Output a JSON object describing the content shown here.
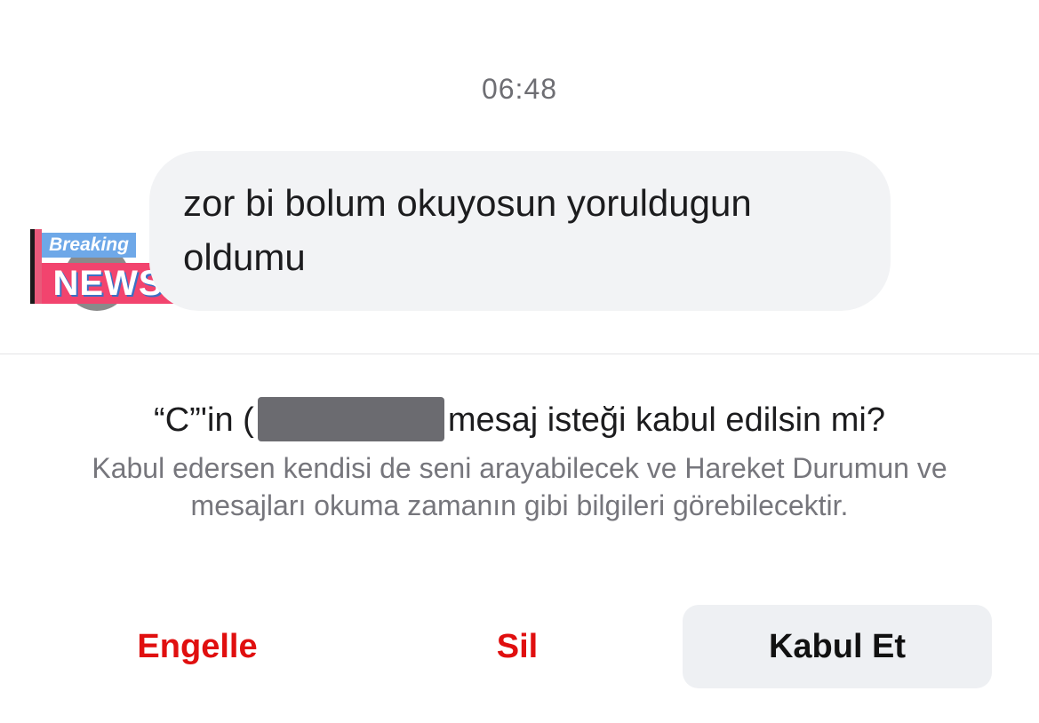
{
  "conversation": {
    "timestamp": "06:48",
    "message": {
      "text": "zor bi bolum okuyosun yoruldugun oldumu"
    },
    "avatar": {
      "line1": "Breaking",
      "line2": "NEWS"
    }
  },
  "request": {
    "title_prefix": "“C”'in (",
    "title_suffix": "mesaj isteği kabul edilsin mi?",
    "description": "Kabul edersen kendisi de seni arayabilecek ve Hareket Durumun ve mesajları okuma zamanın gibi bilgileri görebilecektir."
  },
  "actions": {
    "block_label": "Engelle",
    "delete_label": "Sil",
    "accept_label": "Kabul Et"
  },
  "colors": {
    "destructive": "#e00f0f",
    "bubble_bg": "#f2f3f5",
    "accept_bg": "#eef0f3"
  }
}
